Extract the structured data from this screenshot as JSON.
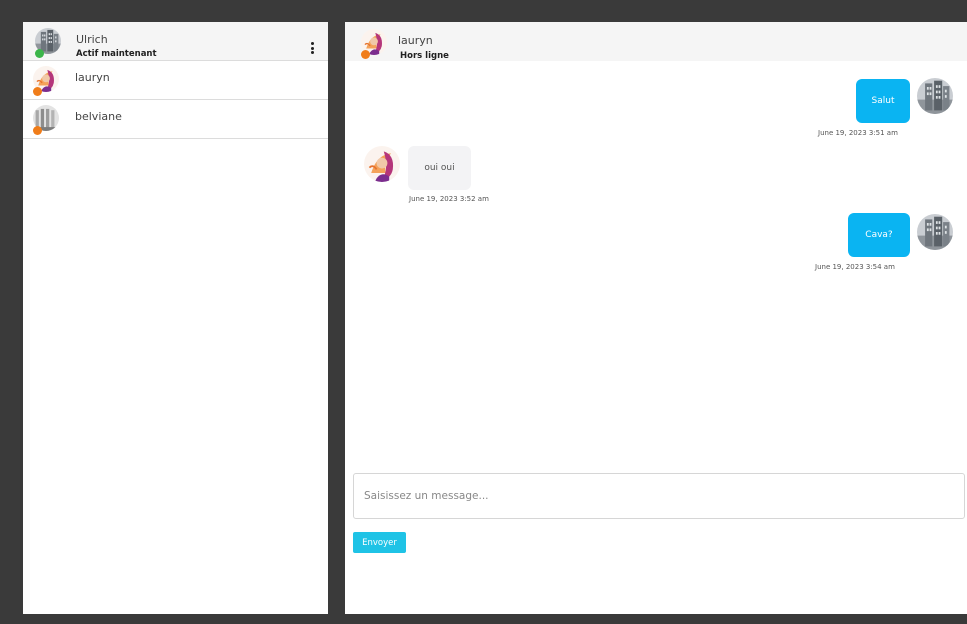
{
  "current_user": {
    "name": "Ulrich",
    "status": "Actif maintenant",
    "menu_icon": "vertical-ellipsis-icon",
    "status_color": "#3bb54a"
  },
  "contacts": [
    {
      "name": "lauryn",
      "status_color": "#f07d1a"
    },
    {
      "name": "belviane",
      "status_color": "#f07d1a"
    }
  ],
  "chat": {
    "name": "lauryn",
    "status": "Hors ligne",
    "status_color": "#f07d1a",
    "messages": [
      {
        "direction": "sent",
        "text": "Salut",
        "time": "June 19, 2023 3:51 am"
      },
      {
        "direction": "received",
        "text": "oui oui",
        "time": "June 19, 2023 3:52 am"
      },
      {
        "direction": "sent",
        "text": "Cava?",
        "time": "June 19, 2023 3:54 am"
      }
    ]
  },
  "composer": {
    "placeholder": "Saisissez un message...",
    "value": ""
  },
  "send_button": {
    "label": "Envoyer"
  },
  "colors": {
    "sent_bubble": "#0ab4f2",
    "received_bubble": "#f3f3f5",
    "send_button": "#1fc3e6",
    "background": "#3a3a3a"
  }
}
